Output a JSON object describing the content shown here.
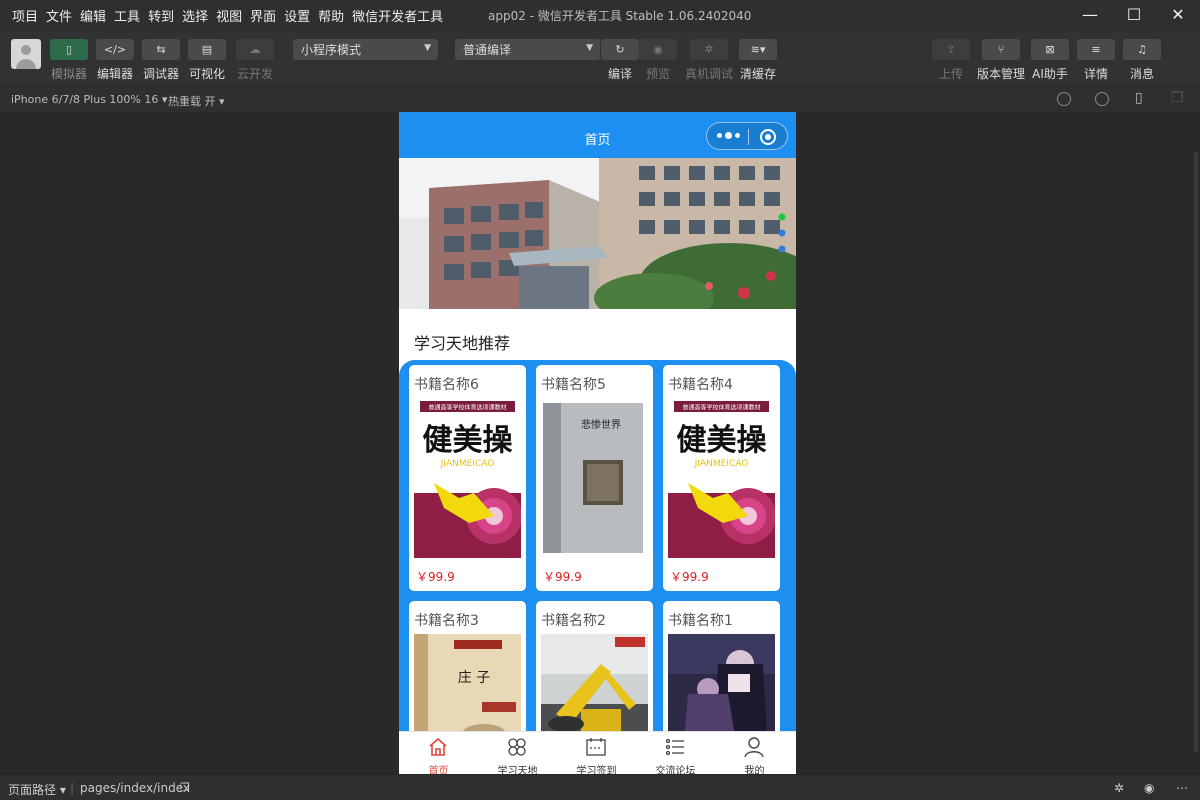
{
  "titlebar": {
    "menu": [
      "项目",
      "文件",
      "编辑",
      "工具",
      "转到",
      "选择",
      "视图",
      "界面",
      "设置",
      "帮助",
      "微信开发者工具"
    ],
    "window_title": "app02 - 微信开发者工具 Stable 1.06.2402040"
  },
  "toolbar": {
    "left_buttons": [
      {
        "label": "模拟器",
        "icon": "phone-icon",
        "state": "active"
      },
      {
        "label": "编辑器",
        "icon": "code-icon",
        "state": "normal"
      },
      {
        "label": "调试器",
        "icon": "debug-icon",
        "state": "normal"
      },
      {
        "label": "可视化",
        "icon": "layout-icon",
        "state": "normal"
      },
      {
        "label": "云开发",
        "icon": "cloud-icon",
        "state": "disabled"
      }
    ],
    "mode_select": "小程序模式",
    "compile_select": "普通编译",
    "mid_buttons": [
      {
        "label": "编译",
        "icon": "refresh-icon",
        "state": "normal"
      },
      {
        "label": "预览",
        "icon": "eye-icon",
        "state": "disabled"
      },
      {
        "label": "真机调试",
        "icon": "bug-icon",
        "state": "disabled"
      },
      {
        "label": "清缓存",
        "icon": "layers-icon",
        "state": "normal"
      }
    ],
    "right_buttons": [
      {
        "label": "上传",
        "icon": "upload-icon",
        "state": "disabled"
      },
      {
        "label": "版本管理",
        "icon": "branch-icon",
        "state": "normal"
      },
      {
        "label": "AI助手",
        "icon": "ai-icon",
        "state": "normal"
      },
      {
        "label": "详情",
        "icon": "menu-icon",
        "state": "normal"
      },
      {
        "label": "消息",
        "icon": "bell-icon",
        "state": "normal"
      }
    ]
  },
  "devbar": {
    "device": "iPhone 6/7/8 Plus 100% 16",
    "hot_reload": "热重载 开"
  },
  "app": {
    "nav_title": "首页",
    "section_title": "学习天地推荐",
    "books": [
      {
        "name": "书籍名称6",
        "price": "￥99.9",
        "cover": "fitness"
      },
      {
        "name": "书籍名称5",
        "price": "￥99.9",
        "cover": "classic"
      },
      {
        "name": "书籍名称4",
        "price": "￥99.9",
        "cover": "fitness"
      },
      {
        "name": "书籍名称3",
        "price": "",
        "cover": "zhuangzi"
      },
      {
        "name": "书籍名称2",
        "price": "",
        "cover": "excavator"
      },
      {
        "name": "书籍名称1",
        "price": "",
        "cover": "anime"
      }
    ],
    "covers": {
      "fitness_header": "普通高等学校体育选项课教材",
      "fitness_title": "健美操",
      "fitness_pinyin": "JIANMEICAO",
      "classic_title": "悲惨世界",
      "zhuangzi_title": "庄 子"
    },
    "tabs": [
      {
        "label": "首页",
        "icon": "home-icon",
        "active": true
      },
      {
        "label": "学习天地",
        "icon": "clover-icon",
        "active": false
      },
      {
        "label": "学习签到",
        "icon": "calendar-icon",
        "active": false
      },
      {
        "label": "交流论坛",
        "icon": "list-icon",
        "active": false
      },
      {
        "label": "我的",
        "icon": "user-icon",
        "active": false
      }
    ]
  },
  "statusbar": {
    "page_path_label": "页面路径",
    "page_path": "pages/index/index"
  },
  "colors": {
    "accent_blue": "#1d8ff0",
    "price_red": "#e02020",
    "active_tab": "#e0463a"
  }
}
